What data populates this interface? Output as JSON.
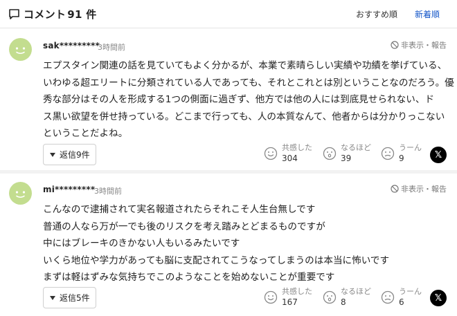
{
  "header": {
    "title": "コメント",
    "count": "91",
    "count_suffix": "件",
    "sort_recommend": "おすすめ順",
    "sort_new": "新着順"
  },
  "comments": [
    {
      "user": "sak*********",
      "time": "3時間前",
      "report": "非表示・報告",
      "lines": [
        "エプスタイン関連の話を見ていてもよく分かるが、本業で素晴らしい実績や功績を挙げている、",
        "いわゆる超エリートに分類されている人であっても、それとこれとは別ということなのだろう。優",
        "秀な部分はその人を形成する1つの側面に過ぎず、他方では他の人には到底見せられない、ド",
        "ス黒い欲望を併せ持っている。どこまで行っても、人の本質なんて、他者からは分かりっこない",
        "ということだよね。"
      ],
      "reply": "返信9件",
      "reactions": {
        "agree_label": "共感した",
        "agree_count": "304",
        "naruhodo_label": "なるほど",
        "naruhodo_count": "39",
        "uun_label": "うーん",
        "uun_count": "9"
      },
      "x_label": "𝕏"
    },
    {
      "user": "mi*********",
      "time": "3時間前",
      "report": "非表示・報告",
      "lines": [
        "こんなので逮捕されて実名報道されたらそれこそ人生台無しです",
        "普通の人なら万が一でも後のリスクを考え踏みとどまるものですが",
        "中にはブレーキのきかない人もいるみたいです",
        "いくら地位や学力があっても脳に支配されてこうなってしまうのは本当に怖いです",
        "まずは軽はずみな気持ちでこのようなことを始めないことが重要です"
      ],
      "reply": "返信5件",
      "reactions": {
        "agree_label": "共感した",
        "agree_count": "167",
        "naruhodo_label": "なるほど",
        "naruhodo_count": "8",
        "uun_label": "うーん",
        "uun_count": "6"
      },
      "x_label": "𝕏"
    }
  ],
  "colors": {
    "avatar": "#c3dd8f",
    "avatar_face": "#ffffff",
    "link_blue": "#1456c8",
    "separator": "#f2f2f2"
  }
}
